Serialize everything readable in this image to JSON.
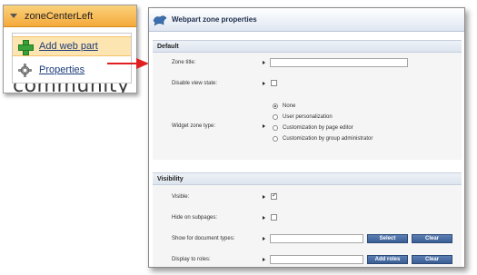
{
  "context_menu": {
    "zone_name": "zoneCenterLeft",
    "items": [
      "Add web part",
      "Properties"
    ],
    "background_text": "community"
  },
  "dialog": {
    "title": "Webpart zone properties",
    "sections": {
      "default": {
        "header": "Default",
        "zone_title_label": "Zone title:",
        "zone_title_value": "",
        "disable_view_state_label": "Disable view state:",
        "disable_view_state_checked": false,
        "widget_zone_type_label": "Widget zone type:",
        "widget_zone_type_options": [
          "None",
          "User personalization",
          "Customization by page editor",
          "Customization by group administrator"
        ],
        "widget_zone_type_selected": "None"
      },
      "visibility": {
        "header": "Visibility",
        "visible_label": "Visible:",
        "visible_checked": true,
        "hide_on_subpages_label": "Hide on subpages:",
        "hide_on_subpages_checked": false,
        "show_for_document_types_label": "Show for document types:",
        "show_for_document_types_value": "",
        "select_button": "Select",
        "clear_button": "Clear",
        "display_to_roles_label": "Display to roles:",
        "add_roles_button": "Add roles",
        "clear_roles_button": "Clear"
      }
    }
  },
  "colors": {
    "menu_header": "#f4a93b",
    "menu_highlight": "#fde5b1",
    "arrow": "#e02020",
    "button": "#4a6fa5",
    "section_bg": "#f5f5f5"
  }
}
